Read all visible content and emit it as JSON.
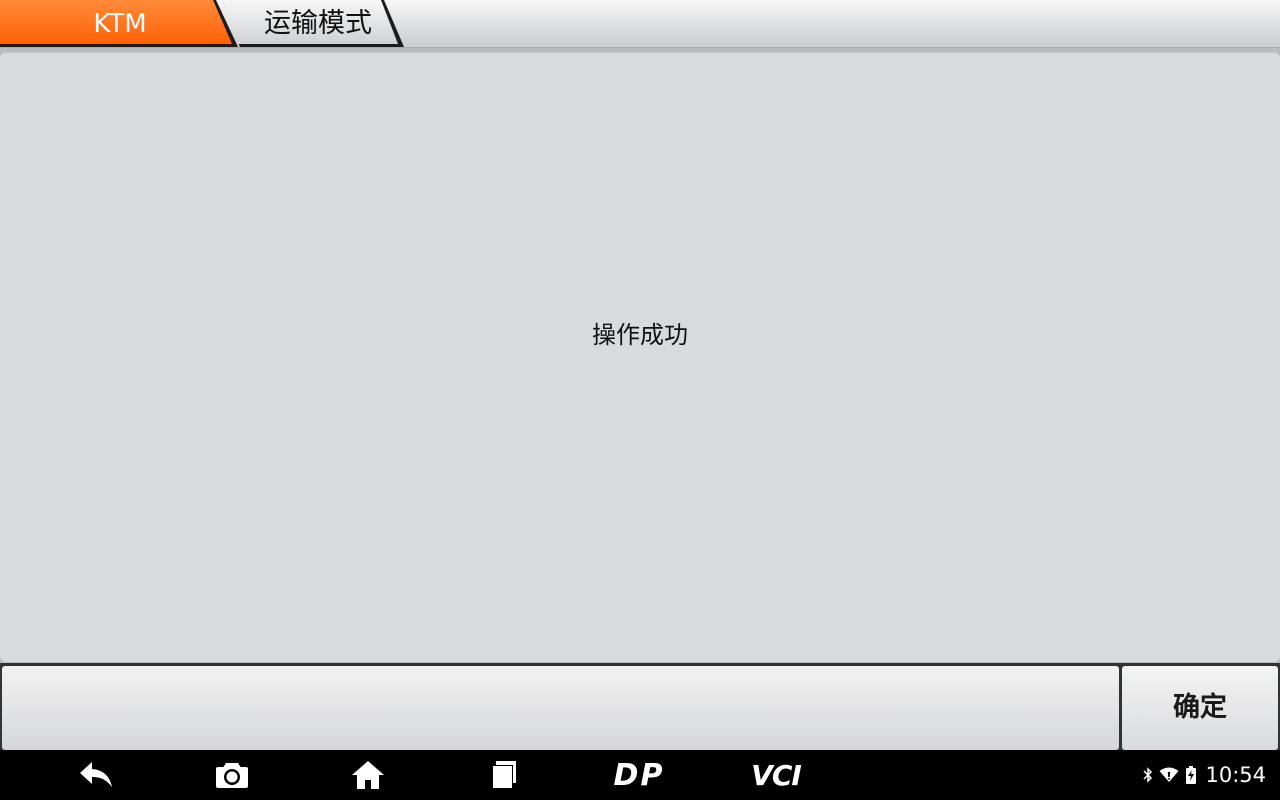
{
  "breadcrumb": {
    "items": [
      "KTM",
      "运输模式"
    ],
    "active_color": "#ff6a10"
  },
  "main": {
    "message": "操作成功"
  },
  "actions": {
    "ok_label": "确定"
  },
  "navbar": {
    "buttons": [
      "back-icon",
      "camera-icon",
      "home-icon",
      "recents-icon",
      "dp-logo",
      "vci-logo"
    ],
    "dp_label": "DP",
    "vci_label": "VCI"
  },
  "status_bar": {
    "icons": [
      "bluetooth-icon",
      "wifi-icon",
      "battery-icon"
    ],
    "time": "10:54"
  }
}
